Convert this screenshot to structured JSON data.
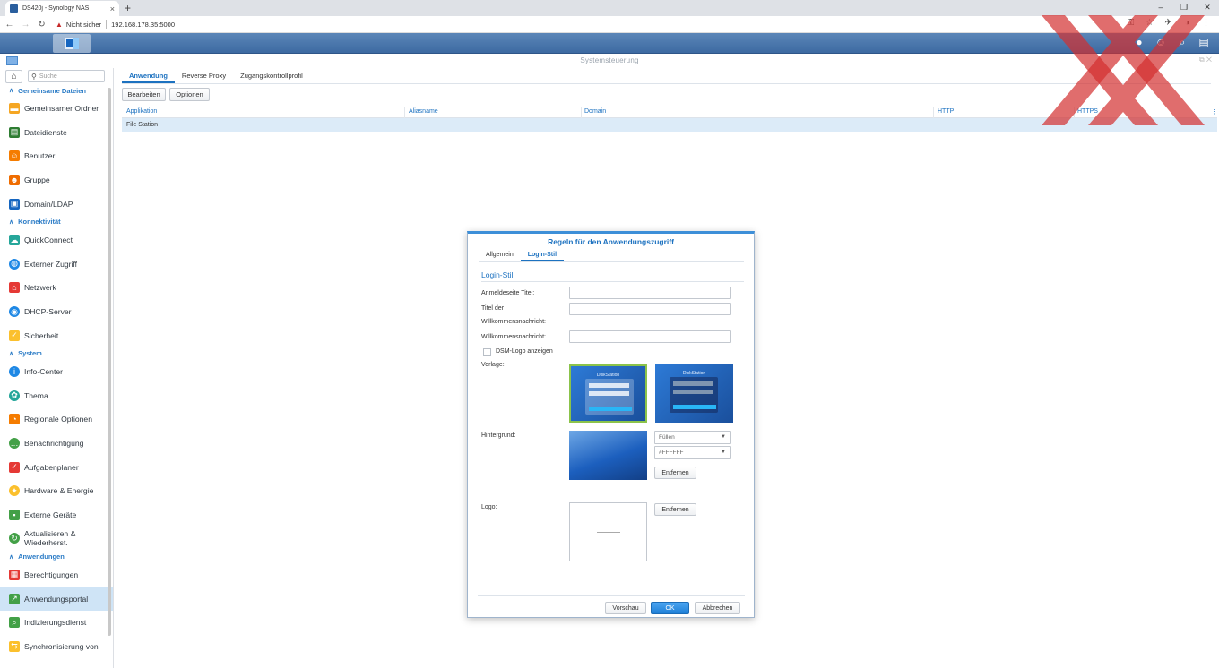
{
  "browser": {
    "tab_title": "DS420j - Synology NAS",
    "tab_close": "×",
    "new_tab": "+",
    "security_label": "Nicht sicher",
    "url": "192.168.178.35:5000"
  },
  "window": {
    "title": "Systemsteuerung"
  },
  "sidebar": {
    "search_placeholder": "Suche",
    "sections": [
      {
        "title": "Gemeinsame Dateien"
      },
      {
        "title": "Konnektivität"
      },
      {
        "title": "System"
      },
      {
        "title": "Anwendungen"
      }
    ],
    "items": [
      {
        "label": "Gemeinsamer Ordner",
        "color": "#f5a623"
      },
      {
        "label": "Dateidienste",
        "color": "#2e7d32"
      },
      {
        "label": "Benutzer",
        "color": "#f57c00"
      },
      {
        "label": "Gruppe",
        "color": "#ef6c00"
      },
      {
        "label": "Domain/LDAP",
        "color": "#1565c0"
      },
      {
        "label": "QuickConnect",
        "color": "#26a69a"
      },
      {
        "label": "Externer Zugriff",
        "color": "#1e88e5"
      },
      {
        "label": "Netzwerk",
        "color": "#e53935"
      },
      {
        "label": "DHCP-Server",
        "color": "#1e88e5"
      },
      {
        "label": "Sicherheit",
        "color": "#fbc02d"
      },
      {
        "label": "Info-Center",
        "color": "#1e88e5"
      },
      {
        "label": "Thema",
        "color": "#26a69a"
      },
      {
        "label": "Regionale Optionen",
        "color": "#f57c00"
      },
      {
        "label": "Benachrichtigung",
        "color": "#43a047"
      },
      {
        "label": "Aufgabenplaner",
        "color": "#e53935"
      },
      {
        "label": "Hardware & Energie",
        "color": "#fbc02d"
      },
      {
        "label": "Externe Geräte",
        "color": "#43a047"
      },
      {
        "label": "Aktualisieren &",
        "label2": "Wiederherst.",
        "color": "#43a047"
      },
      {
        "label": "Berechtigungen",
        "color": "#e53935"
      },
      {
        "label": "Anwendungsportal",
        "color": "#43a047"
      },
      {
        "label": "Indizierungsdienst",
        "color": "#43a047"
      },
      {
        "label": "Synchronisierung von",
        "color": "#fbc02d"
      }
    ]
  },
  "main": {
    "tabs": [
      "Anwendung",
      "Reverse Proxy",
      "Zugangskontrollprofil"
    ],
    "toolbar": {
      "edit": "Bearbeiten",
      "options": "Optionen"
    },
    "columns": [
      "Applikation",
      "Aliasname",
      "Domain",
      "HTTP",
      "HTTPS"
    ],
    "rows": [
      {
        "application": "File Station"
      }
    ]
  },
  "dialog": {
    "title": "Regeln für den Anwendungszugriff",
    "tabs": [
      "Allgemein",
      "Login-Stil"
    ],
    "section_title": "Login-Stil",
    "labels": {
      "login_title": "Anmeldeseite Titel:",
      "welcome_title_1": "Titel der",
      "welcome_title_2": "Willkommensnachricht:",
      "welcome_msg": "Willkommensnachricht:",
      "show_logo": "DSM-Logo anzeigen",
      "template": "Vorlage:",
      "background": "Hintergrund:",
      "logo": "Logo:"
    },
    "fields": {
      "login_title": "",
      "welcome_title": "",
      "welcome_msg": ""
    },
    "show_logo_checked": false,
    "template_brand": "DiskStation",
    "background_mode": "Füllen",
    "background_color": "#FFFFFF",
    "remove_label": "Entfernen",
    "buttons": {
      "preview": "Vorschau",
      "ok": "OK",
      "cancel": "Abbrechen"
    }
  }
}
